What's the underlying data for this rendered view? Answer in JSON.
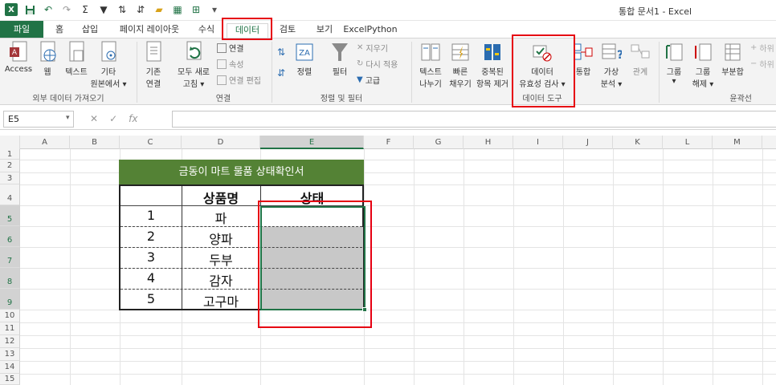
{
  "window": {
    "title": "통합 문서1 - Excel"
  },
  "tabs": [
    "파일",
    "홈",
    "삽입",
    "페이지 레이아웃",
    "수식",
    "데이터",
    "검토",
    "보기",
    "ExcelPython"
  ],
  "active_tab": "데이터",
  "ribbon": {
    "groups": {
      "external": "외부 데이터 가져오기",
      "connections": "연결",
      "sort_filter": "정렬 및 필터",
      "data_tools": "데이터 도구",
      "outline": "윤곽선"
    },
    "buttons": {
      "access": "Access",
      "web": "웹",
      "text": "텍스트",
      "other_1": "기타",
      "other_2": "원본에서 ▾",
      "existing_1": "기존",
      "existing_2": "연결",
      "refresh_1": "모두 새로",
      "refresh_2": "고침 ▾",
      "connections": "연결",
      "properties": "속성",
      "edit_links": "연결 편집",
      "sort": "정렬",
      "filter": "필터",
      "clear": "지우기",
      "reapply": "다시 적용",
      "advanced": "고급",
      "text_to_col_1": "텍스트",
      "text_to_col_2": "나누기",
      "flash_fill_1": "빠른",
      "flash_fill_2": "채우기",
      "remove_dup_1": "중복된",
      "remove_dup_2": "항목 제거",
      "validation_1": "데이터",
      "validation_2": "유효성 검사 ▾",
      "consolidate": "통합",
      "whatif_1": "가상",
      "whatif_2": "분석 ▾",
      "relationships": "관계",
      "group": "그룹",
      "ungroup_1": "그룹",
      "ungroup_2": "해제 ▾",
      "subtotal": "부분합",
      "show_detail": "하위",
      "hide_detail": "하위"
    }
  },
  "formula_bar": {
    "name_box": "E5",
    "fx": "fx",
    "cancel": "✕",
    "enter": "✓",
    "formula": ""
  },
  "columns": [
    "A",
    "B",
    "C",
    "D",
    "E",
    "F",
    "G",
    "H",
    "I",
    "J",
    "K",
    "L",
    "M"
  ],
  "rows": [
    "1",
    "2",
    "3",
    "4",
    "5",
    "6",
    "7",
    "8",
    "9",
    "10",
    "11",
    "12",
    "13",
    "14",
    "15"
  ],
  "sheet": {
    "title": "금동이 마트 물품 상태확인서",
    "headers": {
      "name": "상품명",
      "status": "상태"
    },
    "items": [
      {
        "no": "1",
        "name": "파"
      },
      {
        "no": "2",
        "name": "양파"
      },
      {
        "no": "3",
        "name": "두부"
      },
      {
        "no": "4",
        "name": "감자"
      },
      {
        "no": "5",
        "name": "고구마"
      }
    ]
  },
  "colors": {
    "excel_green": "#217346",
    "title_fill": "#548235",
    "highlight_red": "#e60012",
    "gray_fill": "#c8c8c8"
  }
}
